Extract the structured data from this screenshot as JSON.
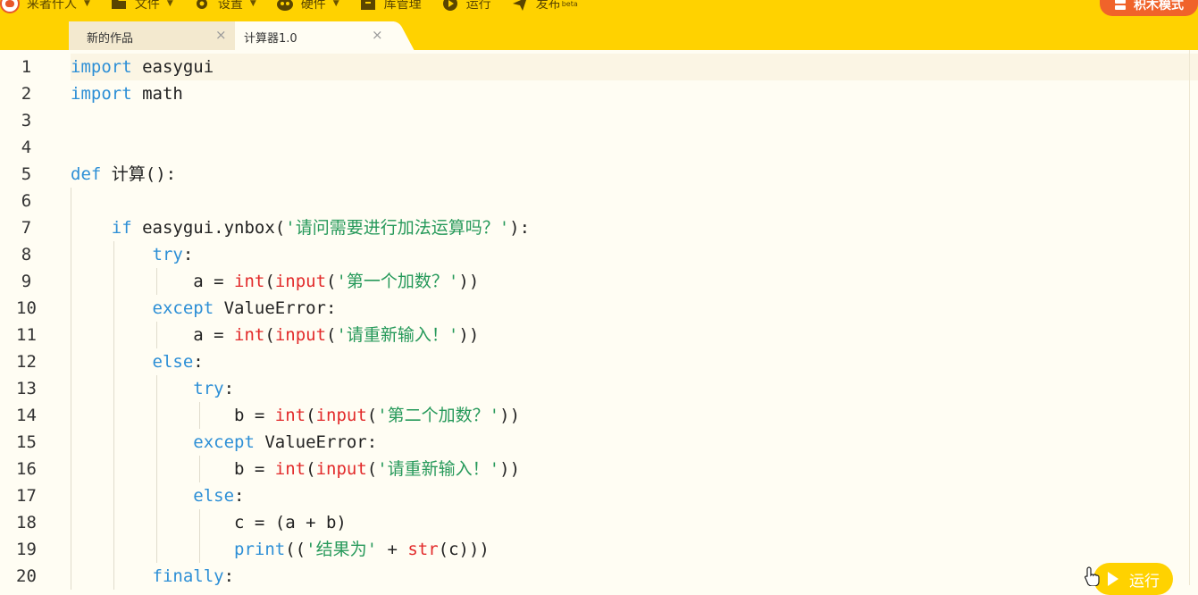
{
  "menu": {
    "items": [
      {
        "label": "来者什人",
        "icon": "logo-icon"
      },
      {
        "label": "文件",
        "icon": "folder-icon"
      },
      {
        "label": "设置",
        "icon": "gear-icon"
      },
      {
        "label": "硬件",
        "icon": "hardware-icon"
      },
      {
        "label": "库管理",
        "icon": "library-icon"
      },
      {
        "label": "运行",
        "icon": "play-icon"
      },
      {
        "label": "发布",
        "icon": "send-icon",
        "badge": "beta"
      }
    ],
    "mode_button": "积木模式"
  },
  "tabs": [
    {
      "label": "新的作品",
      "close": "×"
    },
    {
      "label": "计算器1.0",
      "close": "×"
    }
  ],
  "editor": {
    "line_numbers": [
      "1",
      "2",
      "3",
      "4",
      "5",
      "6",
      "7",
      "8",
      "9",
      "10",
      "11",
      "12",
      "13",
      "14",
      "15",
      "16",
      "17",
      "18",
      "19",
      "20"
    ],
    "tokens": {
      "import": "import",
      "easygui": " easygui",
      "math": " math",
      "def": "def",
      "fn": " 计算():",
      "if": "if",
      "ynbox_pre": " easygui.ynbox(",
      "ynbox_str": "'请问需要进行加法运算吗？'",
      "ynbox_post": "):",
      "try": "try",
      "colon": ":",
      "a_assign": "a = ",
      "b_assign": "b = ",
      "int": "int",
      "open_paren": "(",
      "input": "input",
      "str1": "'第一个加数？'",
      "str2": "'第二个加数？'",
      "str_retry": "'请重新输入！'",
      "close2": "))",
      "except": "except",
      "valueerror": " ValueError:",
      "else": "else",
      "c_assign": "c = (a + b)",
      "print": "print",
      "print_open": "((",
      "str_result": "'结果为'",
      "plus": " + ",
      "str": "str",
      "c_close": "(c)))",
      "finally": "finally"
    }
  },
  "run_button": "运行",
  "colors": {
    "accent": "#ffd200",
    "keyword": "#2d8fd6",
    "builtin": "#e22a2a",
    "string": "#26995a",
    "mode_button": "#f0632a"
  }
}
